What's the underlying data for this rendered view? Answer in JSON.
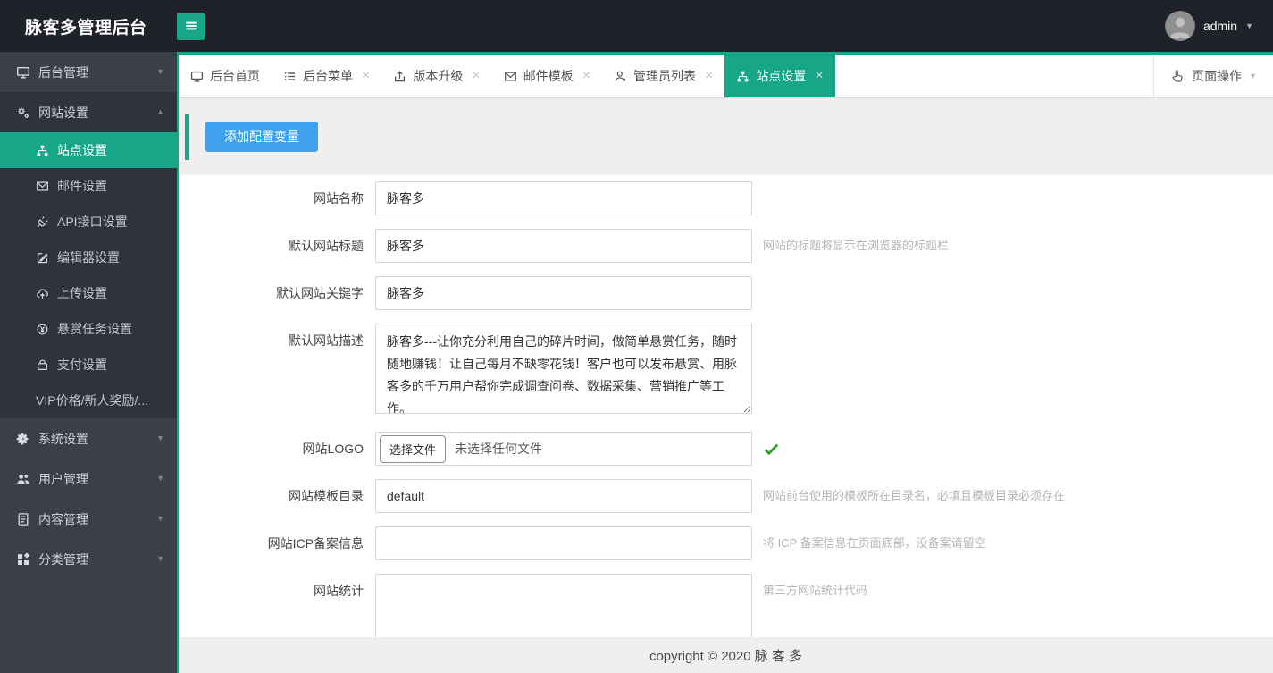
{
  "app": {
    "title": "脉客多管理后台",
    "user": "admin"
  },
  "colors": {
    "accent_green": "#18a689",
    "button_blue": "#3ea1ee",
    "header_bg": "#1f2329",
    "sidebar_bg": "#3a3f49",
    "check_green": "#2aa22a"
  },
  "sidebar": {
    "items": [
      {
        "label": "后台管理",
        "icon": "monitor"
      },
      {
        "label": "网站设置",
        "icon": "gears",
        "expanded": true,
        "children": [
          {
            "label": "站点设置",
            "icon": "sitemap",
            "active": true
          },
          {
            "label": "邮件设置",
            "icon": "envelope"
          },
          {
            "label": "API接口设置",
            "icon": "plug"
          },
          {
            "label": "编辑器设置",
            "icon": "edit"
          },
          {
            "label": "上传设置",
            "icon": "cloud-upload"
          },
          {
            "label": "悬赏任务设置",
            "icon": "yen"
          },
          {
            "label": "支付设置",
            "icon": "wallet"
          },
          {
            "label": "VIP价格/新人奖励/..."
          }
        ]
      },
      {
        "label": "系统设置",
        "icon": "gear"
      },
      {
        "label": "用户管理",
        "icon": "users"
      },
      {
        "label": "内容管理",
        "icon": "doc"
      },
      {
        "label": "分类管理",
        "icon": "blocks"
      }
    ]
  },
  "tabs": {
    "items": [
      {
        "label": "后台首页",
        "icon": "monitor",
        "closable": false
      },
      {
        "label": "后台菜单",
        "icon": "list",
        "closable": true
      },
      {
        "label": "版本升级",
        "icon": "upload",
        "closable": true
      },
      {
        "label": "邮件模板",
        "icon": "envelope",
        "closable": true
      },
      {
        "label": "管理员列表",
        "icon": "user",
        "closable": true
      },
      {
        "label": "站点设置",
        "icon": "sitemap",
        "closable": true,
        "active": true
      }
    ],
    "page_actions": "页面操作"
  },
  "toolbar": {
    "add_button": "添加配置变量"
  },
  "form": {
    "rows": [
      {
        "label": "网站名称",
        "type": "input",
        "value": "脉客多",
        "hint": ""
      },
      {
        "label": "默认网站标题",
        "type": "input",
        "value": "脉客多",
        "hint": "网站的标题将显示在浏览器的标题栏"
      },
      {
        "label": "默认网站关键字",
        "type": "input",
        "value": "脉客多",
        "hint": ""
      },
      {
        "label": "默认网站描述",
        "type": "textarea",
        "value": "脉客多---让你充分利用自己的碎片时间，做简单悬赏任务，随时随地赚钱！让自己每月不缺零花钱！客户也可以发布悬赏、用脉客多的千万用户帮你完成调查问卷、数据采集、营销推广等工作。",
        "hint": ""
      },
      {
        "label": "网站LOGO",
        "type": "file",
        "button": "选择文件",
        "placeholder": "未选择任何文件",
        "valid": true,
        "hint": ""
      },
      {
        "label": "网站模板目录",
        "type": "input",
        "value": "default",
        "hint": "网站前台使用的模板所在目录名，必填且模板目录必须存在"
      },
      {
        "label": "网站ICP备案信息",
        "type": "input",
        "value": "",
        "hint": "将 ICP 备案信息在页面底部，没备案请留空"
      },
      {
        "label": "网站统计",
        "type": "textarea",
        "value": "",
        "hint": "第三方网站统计代码"
      }
    ]
  },
  "footer": {
    "copyright": "copyright © 2020 脉 客 多"
  }
}
